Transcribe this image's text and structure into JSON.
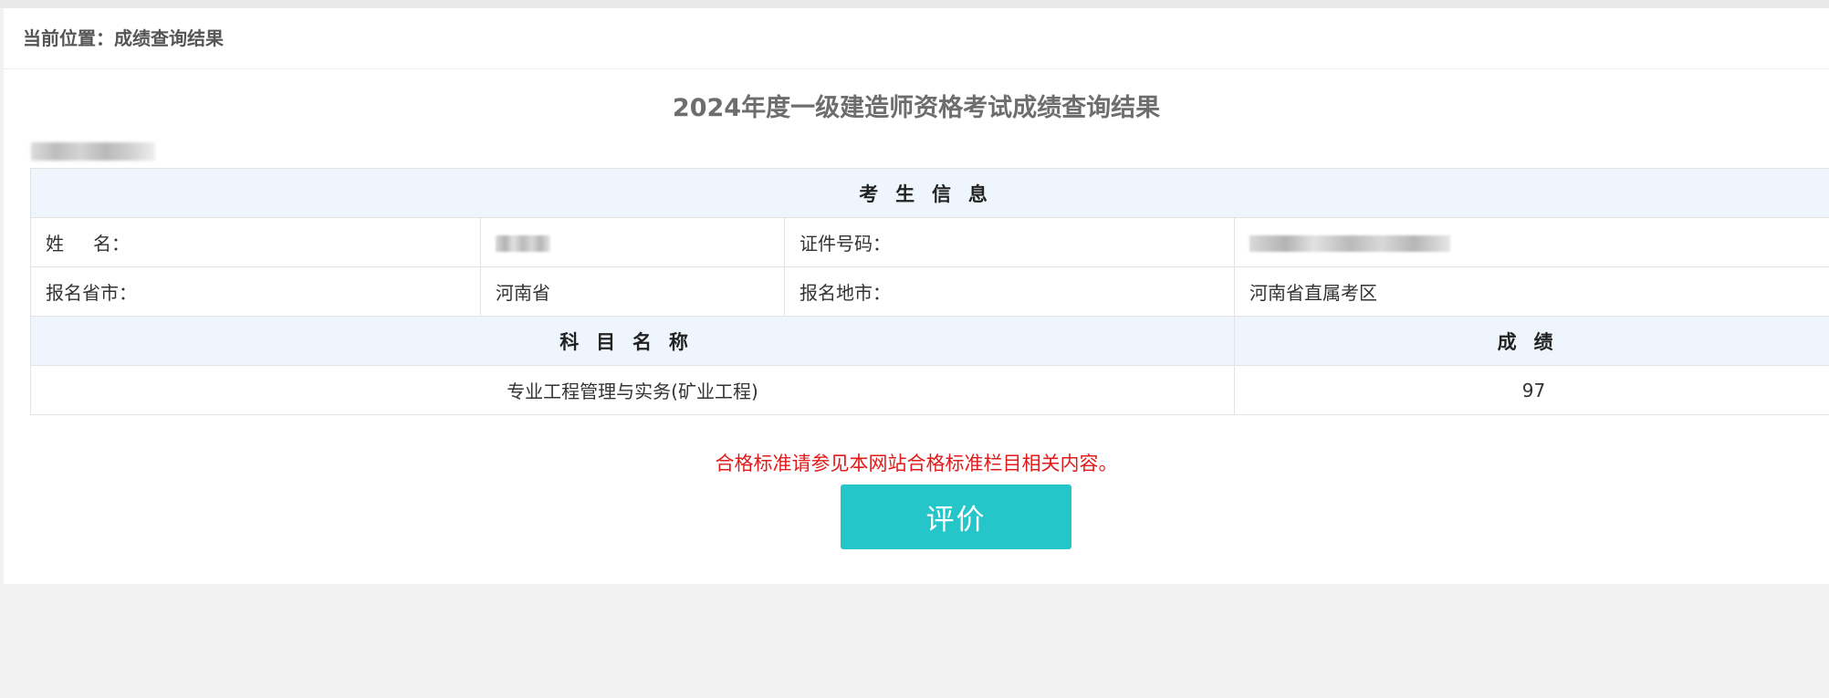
{
  "breadcrumb": {
    "text": "当前位置：成绩查询结果"
  },
  "page": {
    "title": "2024年度一级建造师资格考试成绩查询结果"
  },
  "candidate_info": {
    "header": "考生信息",
    "name_label": "姓名：",
    "id_label": "证件号码：",
    "province_label": "报名省市：",
    "province_value": "河南省",
    "city_label": "报名地市：",
    "city_value": "河南省直属考区"
  },
  "scores": {
    "subject_header": "科目名称",
    "score_header": "成绩",
    "rows": [
      {
        "subject": "专业工程管理与实务(矿业工程)",
        "score": "97"
      }
    ]
  },
  "notice": {
    "text": "合格标准请参见本网站合格标准栏目相关内容。"
  },
  "actions": {
    "rate_label": "评价"
  },
  "colors": {
    "button": "#24c6c9",
    "notice": "#e11b1b",
    "header_bg": "#eef5fc"
  }
}
